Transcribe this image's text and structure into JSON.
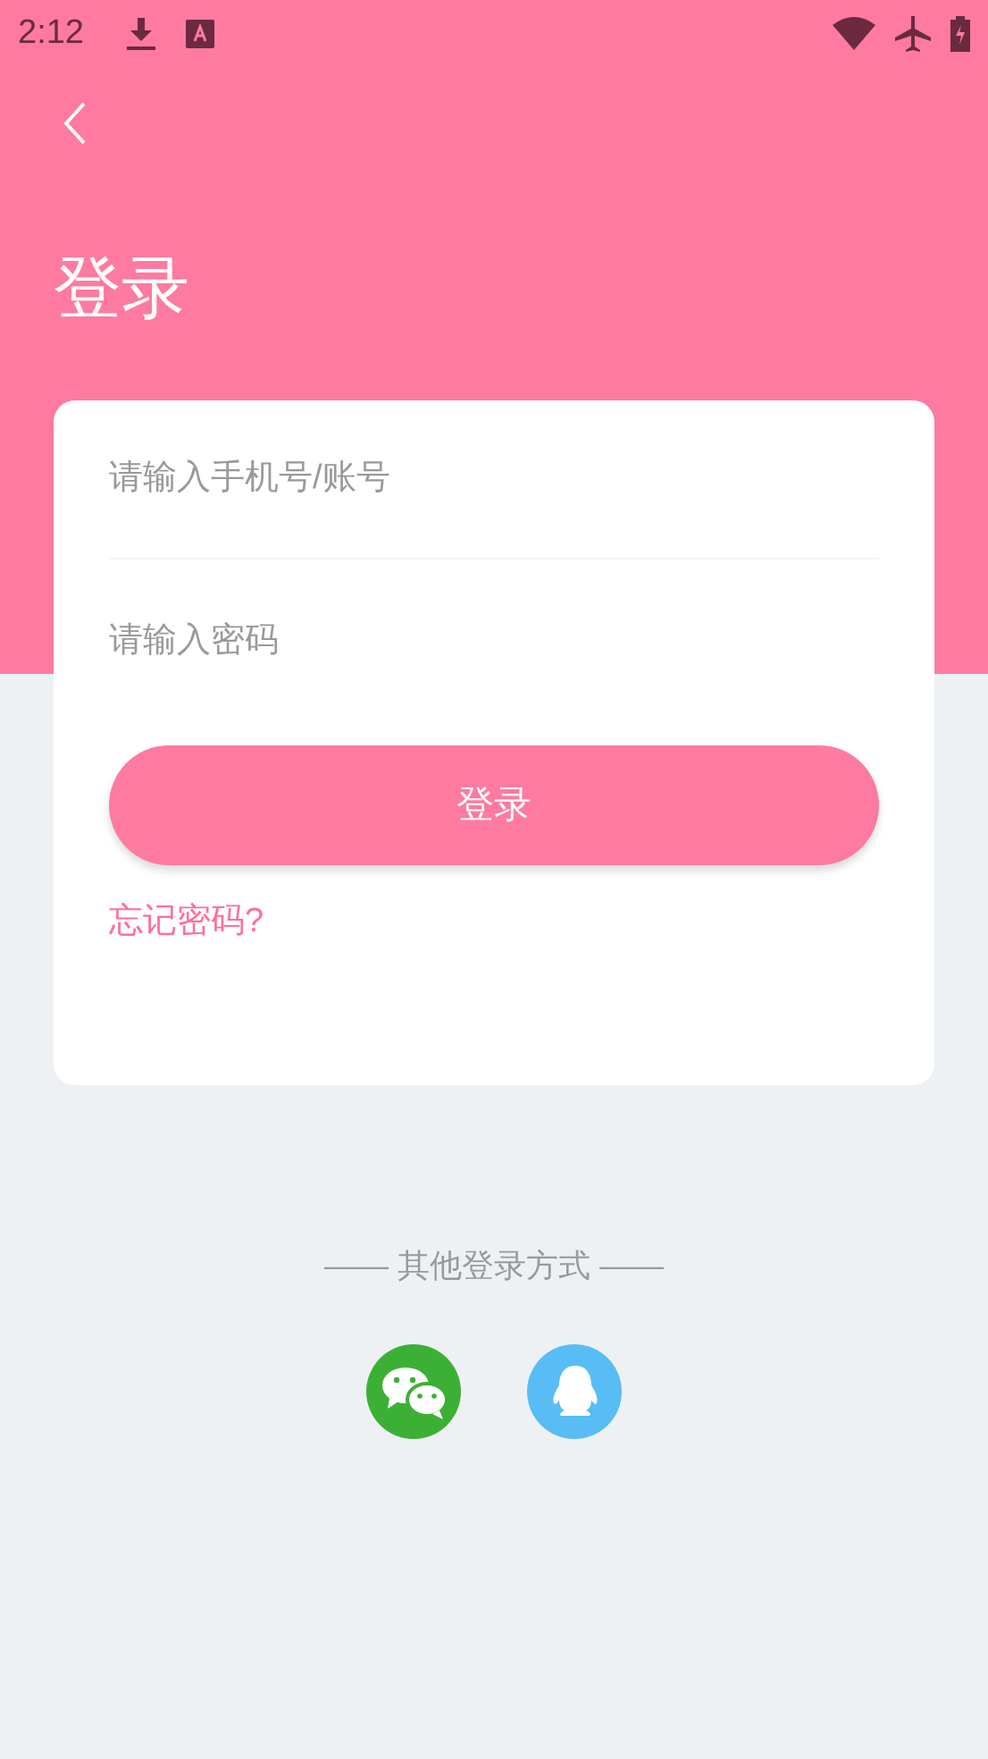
{
  "status_bar": {
    "time": "2:12"
  },
  "title": "登录",
  "form": {
    "account": {
      "placeholder": "请输入手机号/账号"
    },
    "password": {
      "placeholder": "请输入密码"
    },
    "submit": "登录",
    "forgot": "忘记密码?"
  },
  "other_login": {
    "label": "—— 其他登录方式 ——",
    "methods": [
      {
        "kind": "wechat"
      },
      {
        "kind": "qq"
      }
    ]
  }
}
